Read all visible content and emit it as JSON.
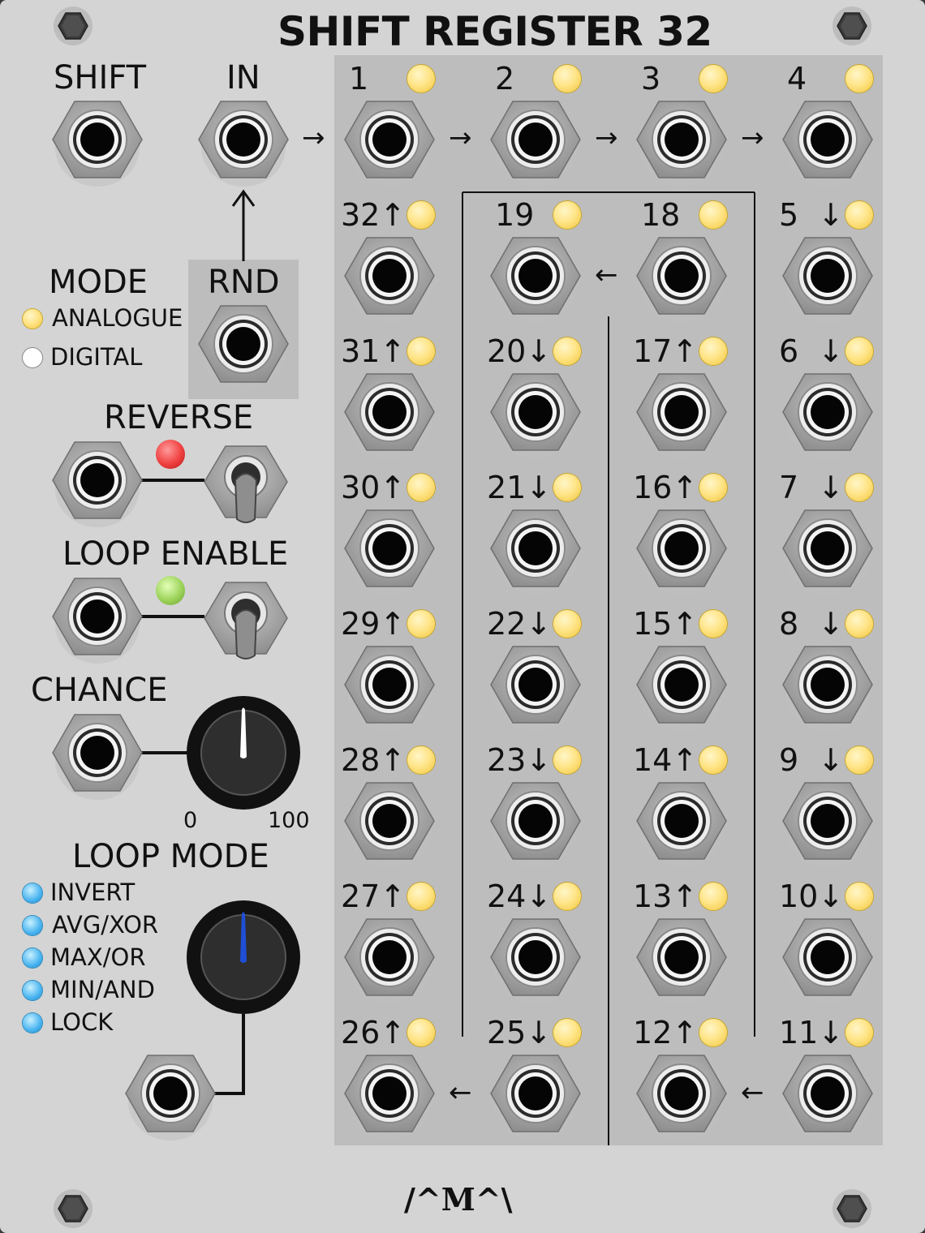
{
  "title": "SHIFT REGISTER 32",
  "logo": "/^M^\\",
  "left": {
    "shift_label": "SHIFT",
    "in_label": "IN",
    "rnd_label": "RND",
    "mode_label": "MODE",
    "mode_options": [
      {
        "label": "ANALOGUE",
        "state": "active",
        "led": "#f1c63a"
      },
      {
        "label": "DIGITAL",
        "state": "inactive",
        "led": "#ffffff"
      }
    ],
    "reverse_label": "REVERSE",
    "reverse_led": "#f04040",
    "loop_enable_label": "LOOP ENABLE",
    "loop_enable_led": "#9cd35a",
    "chance_label": "CHANCE",
    "chance_min": "0",
    "chance_max": "100",
    "loop_mode_label": "LOOP MODE",
    "loop_mode_options": [
      "INVERT",
      "AVG/XOR",
      "MAX/OR",
      "MIN/AND",
      "LOCK"
    ],
    "loop_mode_led": "#48b4f0"
  },
  "arrows": {
    "right": "→",
    "left": "←",
    "up": "↑",
    "down": "↓"
  },
  "grid": {
    "cells": [
      {
        "n": "1",
        "dir": ""
      },
      {
        "n": "2",
        "dir": ""
      },
      {
        "n": "3",
        "dir": ""
      },
      {
        "n": "4",
        "dir": ""
      },
      {
        "n": "32",
        "dir": "↑"
      },
      {
        "n": "19",
        "dir": ""
      },
      {
        "n": "18",
        "dir": ""
      },
      {
        "n": "5",
        "dir": "↓"
      },
      {
        "n": "31",
        "dir": "↑"
      },
      {
        "n": "20",
        "dir": "↓"
      },
      {
        "n": "17",
        "dir": "↑"
      },
      {
        "n": "6",
        "dir": "↓"
      },
      {
        "n": "30",
        "dir": "↑"
      },
      {
        "n": "21",
        "dir": "↓"
      },
      {
        "n": "16",
        "dir": "↑"
      },
      {
        "n": "7",
        "dir": "↓"
      },
      {
        "n": "29",
        "dir": "↑"
      },
      {
        "n": "22",
        "dir": "↓"
      },
      {
        "n": "15",
        "dir": "↑"
      },
      {
        "n": "8",
        "dir": "↓"
      },
      {
        "n": "28",
        "dir": "↑"
      },
      {
        "n": "23",
        "dir": "↓"
      },
      {
        "n": "14",
        "dir": "↑"
      },
      {
        "n": "9",
        "dir": "↓"
      },
      {
        "n": "27",
        "dir": "↑"
      },
      {
        "n": "24",
        "dir": "↓"
      },
      {
        "n": "13",
        "dir": "↑"
      },
      {
        "n": "10",
        "dir": "↓"
      },
      {
        "n": "26",
        "dir": "↑"
      },
      {
        "n": "25",
        "dir": "↓"
      },
      {
        "n": "12",
        "dir": "↑"
      },
      {
        "n": "11",
        "dir": "↓"
      }
    ],
    "led_color": "#ffe58a"
  }
}
